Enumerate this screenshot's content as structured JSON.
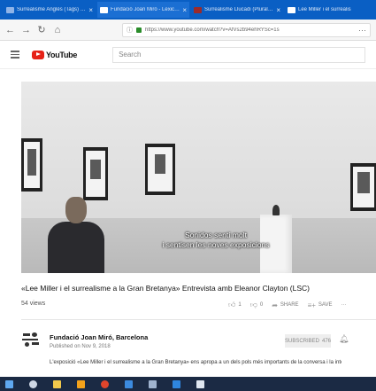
{
  "browser": {
    "tabs": [
      {
        "label": "Surrealisme Anglès (Tags) - arro",
        "fav_color": "#8fb4e8",
        "active": false
      },
      {
        "label": "Fundació Joan Miró - Lexicon",
        "fav_color": "#ffffff",
        "active": true
      },
      {
        "label": "Surrealisme Llucadi (Plural) 53",
        "fav_color": "#9b2b2b",
        "active": false
      },
      {
        "label": "Lee Miller i el surrealis",
        "fav_color": "#ffffff",
        "active": false
      }
    ],
    "close_glyph": "×",
    "url": "https://www.youtube.com/watch?v=AfVs2b94ehRYSc=1s",
    "menu_glyph": "···"
  },
  "youtube": {
    "logo_text": "YouTube",
    "search_placeholder": "Search"
  },
  "video": {
    "subtitle_line1": "Sonidos sentí molt",
    "subtitle_line2": "i sentisen les noves exposicions"
  },
  "info": {
    "title": "«Lee Miller i el surrealisme a la Gran Bretanya» Entrevista amb Eleanor Clayton (LSC)",
    "views": "54 views",
    "likes": "1",
    "dislikes": "0",
    "share_label": "SHARE",
    "save_label": "SAVE",
    "more_glyph": "···"
  },
  "channel": {
    "name": "Fundació Joan Miró, Barcelona",
    "published": "Published on Nov 9, 2018",
    "subscribe_label": "SUBSCRIBED",
    "subscriber_count": "476",
    "description": "L'exposició «Lee Miller i el surrealisme a la Gran Bretanya» ens apropa a un dels pols més importants de la conversa i la interacció del moviment surrealista. Entrevista amb Eleanor"
  },
  "colors": {
    "tabbar": "#0a5fc4",
    "youtube_red": "#e62117",
    "taskbar": "#1b2a44"
  }
}
